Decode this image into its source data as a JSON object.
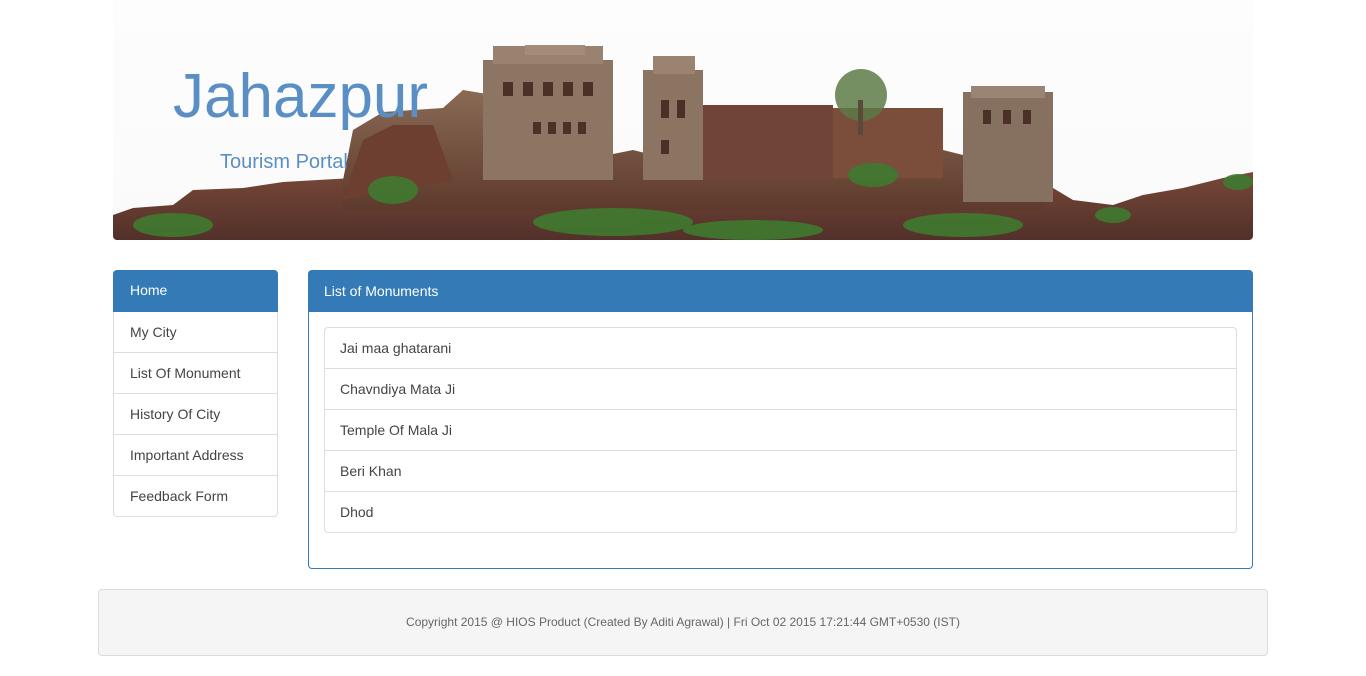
{
  "header": {
    "title": "Jahazpur",
    "subtitle": "Tourism Portal"
  },
  "sidebar": {
    "items": [
      {
        "label": "Home",
        "active": true
      },
      {
        "label": "My City"
      },
      {
        "label": "List Of Monument"
      },
      {
        "label": "History Of City"
      },
      {
        "label": "Important Address"
      },
      {
        "label": "Feedback Form"
      }
    ]
  },
  "main": {
    "panel_title": "List of Monuments",
    "monuments": [
      "Jai maa ghatarani",
      "Chavndiya Mata Ji",
      "Temple Of Mala Ji",
      "Beri Khan",
      "Dhod"
    ]
  },
  "footer": {
    "text": "Copyright 2015 @ HIOS Product (Created By Aditi Agrawal) | Fri Oct 02 2015 17:21:44 GMT+0530 (IST)"
  },
  "colors": {
    "primary": "#337ab7",
    "title": "#5a8fc5"
  }
}
